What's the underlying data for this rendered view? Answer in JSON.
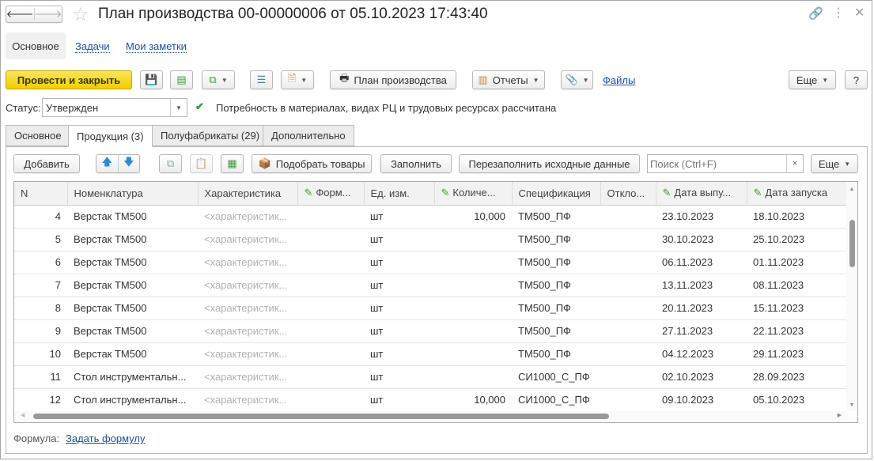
{
  "header": {
    "title": "План производства 00-00000006 от 05.10.2023 17:43:40"
  },
  "nav": {
    "main": "Основное",
    "tasks": "Задачи",
    "notes": "Мои заметки"
  },
  "toolbar": {
    "post_close": "Провести и закрыть",
    "print_plan": "План производства",
    "reports": "Отчеты",
    "files": "Файлы",
    "more": "Еще",
    "help": "?"
  },
  "status": {
    "label": "Статус:",
    "value": "Утвержден",
    "message": "Потребность в материалах, видах РЦ и трудовых ресурсах рассчитана"
  },
  "tabs": [
    "Основное",
    "Продукция (3)",
    "Полуфабрикаты (29)",
    "Дополнительно"
  ],
  "table_toolbar": {
    "add": "Добавить",
    "pick": "Подобрать товары",
    "fill": "Заполнить",
    "refill": "Перезаполнить исходные данные",
    "search_placeholder": "Поиск (Ctrl+F)",
    "clear": "×",
    "more": "Еще"
  },
  "columns": [
    "N",
    "Номенклатура",
    "Характеристика",
    "Форм...",
    "Ед. изм.",
    "Количе...",
    "Спецификация",
    "Откло...",
    "Дата выпу...",
    "Дата запуска"
  ],
  "rows": [
    [
      "4",
      "Верстак ТМ500",
      "<характеристик...",
      "",
      "шт",
      "10,000",
      "ТМ500_ПФ",
      "",
      "23.10.2023",
      "18.10.2023"
    ],
    [
      "5",
      "Верстак ТМ500",
      "<характеристик...",
      "",
      "шт",
      "",
      "ТМ500_ПФ",
      "",
      "30.10.2023",
      "25.10.2023"
    ],
    [
      "6",
      "Верстак ТМ500",
      "<характеристик...",
      "",
      "шт",
      "",
      "ТМ500_ПФ",
      "",
      "06.11.2023",
      "01.11.2023"
    ],
    [
      "7",
      "Верстак ТМ500",
      "<характеристик...",
      "",
      "шт",
      "",
      "ТМ500_ПФ",
      "",
      "13.11.2023",
      "08.11.2023"
    ],
    [
      "8",
      "Верстак ТМ500",
      "<характеристик...",
      "",
      "шт",
      "",
      "ТМ500_ПФ",
      "",
      "20.11.2023",
      "15.11.2023"
    ],
    [
      "9",
      "Верстак ТМ500",
      "<характеристик...",
      "",
      "шт",
      "",
      "ТМ500_ПФ",
      "",
      "27.11.2023",
      "22.11.2023"
    ],
    [
      "10",
      "Верстак ТМ500",
      "<характеристик...",
      "",
      "шт",
      "",
      "ТМ500_ПФ",
      "",
      "04.12.2023",
      "29.11.2023"
    ],
    [
      "11",
      "Стол инструментальн...",
      "<характеристик...",
      "",
      "шт",
      "",
      "СИ1000_С_ПФ",
      "",
      "02.10.2023",
      "28.09.2023"
    ],
    [
      "12",
      "Стол инструментальн...",
      "<характеристик...",
      "",
      "шт",
      "10,000",
      "СИ1000_С_ПФ",
      "",
      "09.10.2023",
      "05.10.2023"
    ]
  ],
  "footer": {
    "formula_label": "Формула:",
    "formula_link": "Задать формулу"
  }
}
